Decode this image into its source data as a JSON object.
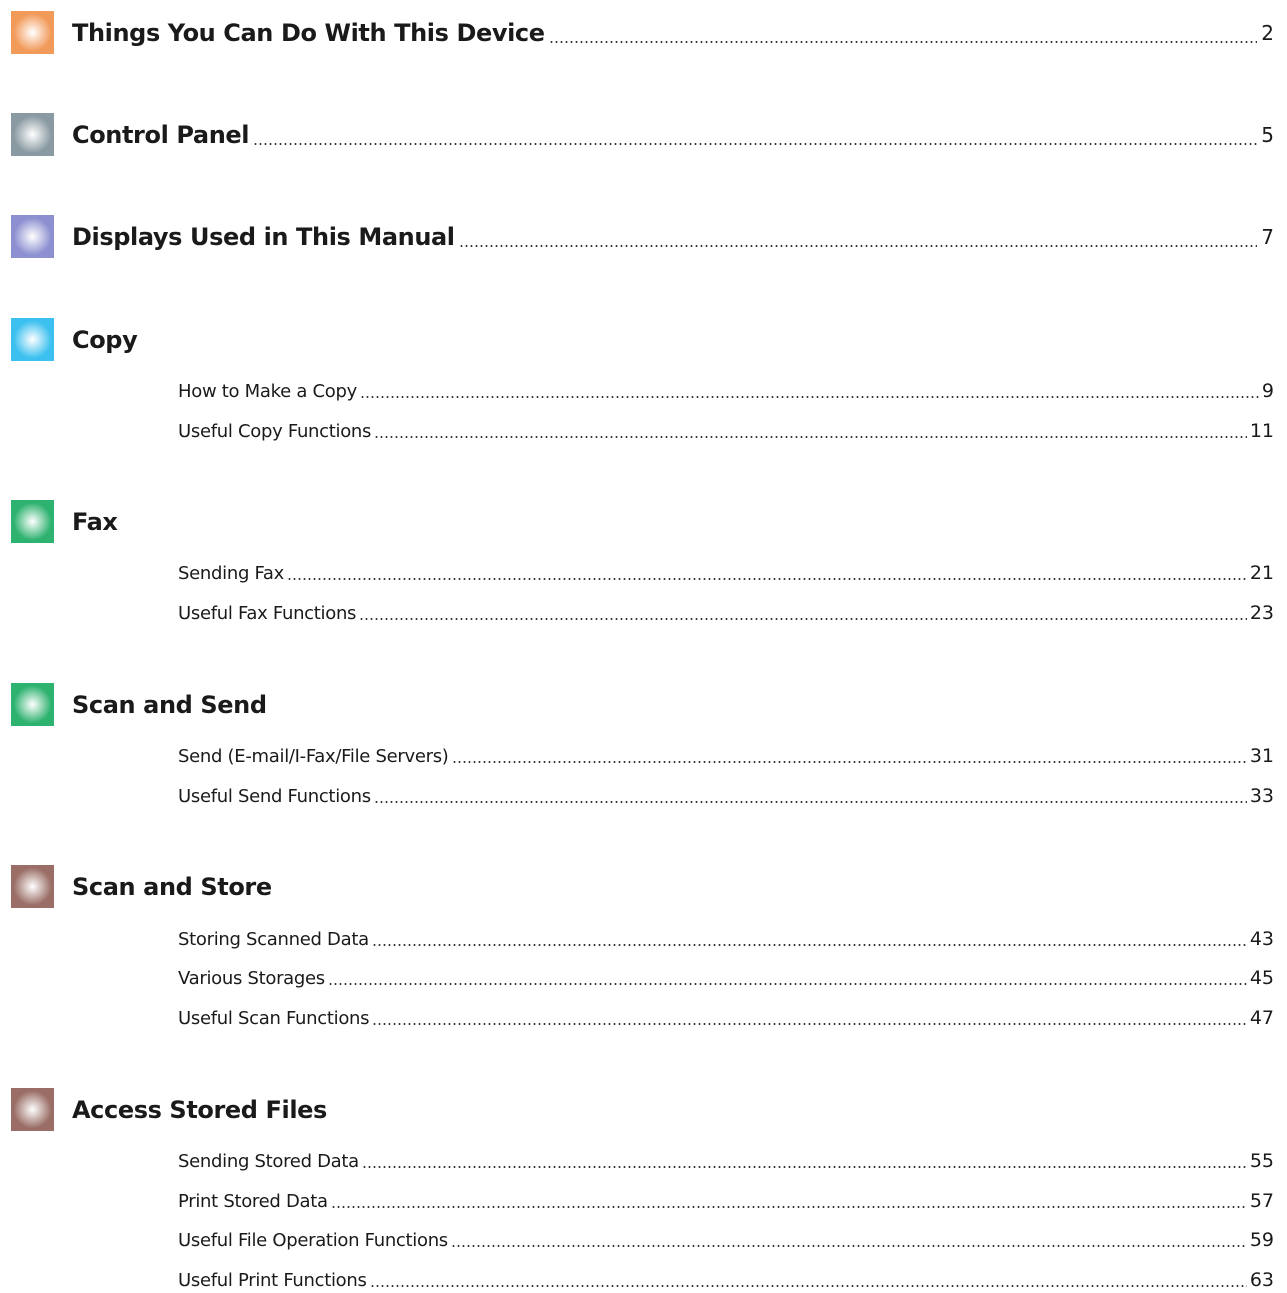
{
  "sections": [
    {
      "title": "Things You Can Do With This Device",
      "page": "2",
      "color": "#f29a5a",
      "icon": "orange-square-icon",
      "entries": []
    },
    {
      "title": "Control Panel",
      "page": "5",
      "color": "#8a9aa2",
      "icon": "gray-square-icon",
      "entries": []
    },
    {
      "title": "Displays Used in This Manual",
      "page": "7",
      "color": "#8c8fd0",
      "icon": "lavender-square-icon",
      "entries": []
    },
    {
      "title": "Copy",
      "page": "",
      "color": "#3cc0ef",
      "icon": "sky-blue-square-icon",
      "entries": [
        {
          "title": "How to Make a Copy",
          "page": "9"
        },
        {
          "title": "Useful Copy Functions",
          "page": "11"
        }
      ]
    },
    {
      "title": "Fax",
      "page": "",
      "color": "#2eb26f",
      "icon": "green-square-icon",
      "entries": [
        {
          "title": "Sending Fax",
          "page": "21"
        },
        {
          "title": "Useful Fax Functions",
          "page": "23"
        }
      ]
    },
    {
      "title": "Scan and Send",
      "page": "",
      "color": "#2eb26f",
      "icon": "green-square-icon",
      "entries": [
        {
          "title": "Send (E-mail/I-Fax/File Servers)",
          "page": "31"
        },
        {
          "title": "Useful Send Functions",
          "page": "33"
        }
      ]
    },
    {
      "title": "Scan and Store",
      "page": "",
      "color": "#9a6e66",
      "icon": "brown-square-icon",
      "entries": [
        {
          "title": "Storing Scanned Data",
          "page": "43"
        },
        {
          "title": "Various Storages",
          "page": "45"
        },
        {
          "title": "Useful Scan Functions",
          "page": "47"
        }
      ]
    },
    {
      "title": "Access Stored Files",
      "page": "",
      "color": "#9a6e66",
      "icon": "brown-square-icon",
      "entries": [
        {
          "title": "Sending Stored Data",
          "page": "55"
        },
        {
          "title": "Print Stored Data",
          "page": "57"
        },
        {
          "title": "Useful File Operation Functions",
          "page": "59"
        },
        {
          "title": "Useful Print Functions",
          "page": "63"
        }
      ]
    }
  ]
}
